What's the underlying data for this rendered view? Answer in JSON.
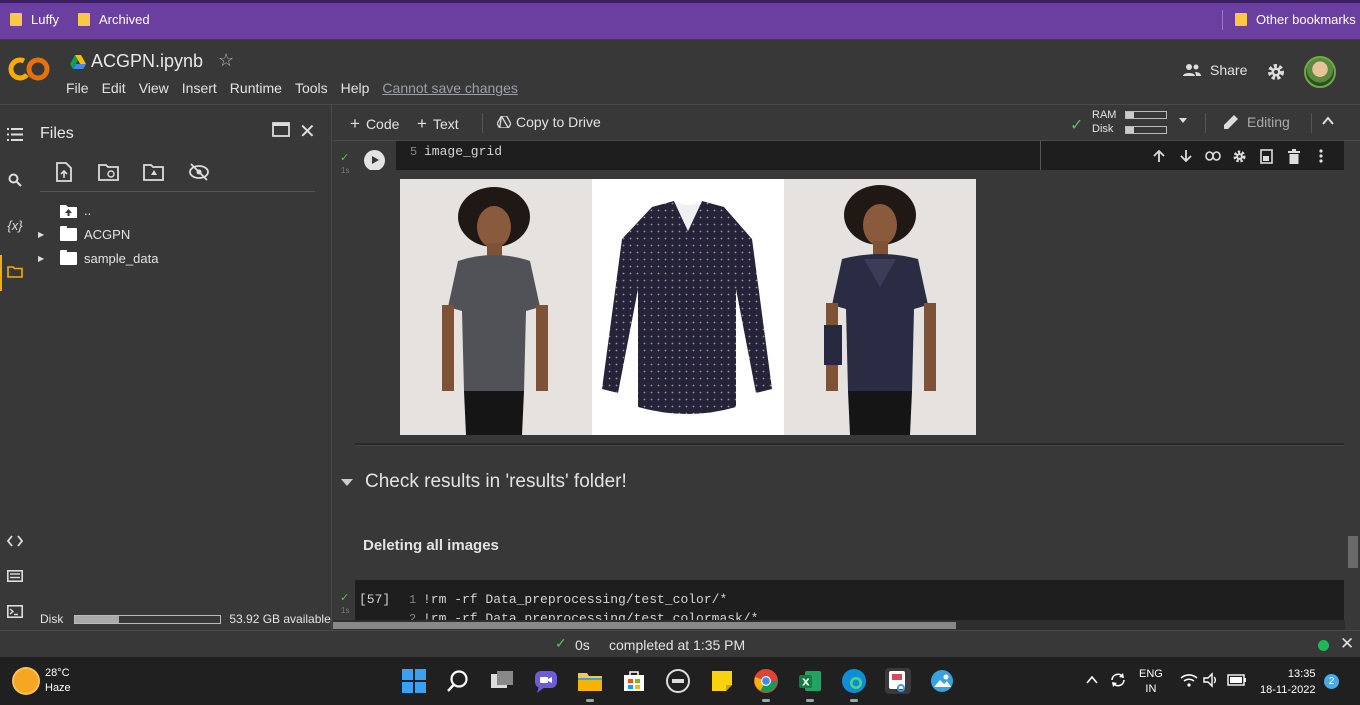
{
  "bookmarks": {
    "items": [
      "Luffy",
      "Archived"
    ],
    "other": "Other bookmarks"
  },
  "header": {
    "notebook_title": "ACGPN.ipynb",
    "menu": [
      "File",
      "Edit",
      "View",
      "Insert",
      "Runtime",
      "Tools",
      "Help"
    ],
    "cannot_save": "Cannot save changes",
    "share_label": "Share"
  },
  "rail": {
    "variables_label": "{x}"
  },
  "files": {
    "title": "Files",
    "tree": [
      {
        "label": ".."
      },
      {
        "label": "ACGPN"
      },
      {
        "label": "sample_data"
      }
    ],
    "disk_label": "Disk",
    "disk_available": "53.92 GB available",
    "disk_used_fraction": 0.3
  },
  "toolbar": {
    "code_label": "Code",
    "text_label": "Text",
    "copy_label": "Copy to Drive",
    "ram_label": "RAM",
    "disk_label": "Disk",
    "ram_used_fraction": 0.2,
    "disk_used_fraction": 0.2,
    "editing_label": "Editing"
  },
  "cell1": {
    "line_number": "5",
    "code": "image_grid",
    "gutter_time": "1s"
  },
  "section": {
    "heading": "Check results in 'results' folder!"
  },
  "text_cell": {
    "text": "Deleting all images"
  },
  "cell2": {
    "exec_count": "[57]",
    "gutter_time": "1s",
    "lines": [
      {
        "n": "1",
        "code": "!rm -rf Data_preprocessing/test_color/*"
      },
      {
        "n": "2",
        "code": "!rm -rf Data_preprocessing/test_colormask/*"
      }
    ]
  },
  "status": {
    "time": "0s",
    "message": "completed at 1:35 PM"
  },
  "taskbar": {
    "temp": "28°C",
    "weather": "Haze",
    "lang_top": "ENG",
    "lang_bottom": "IN",
    "clock_time": "13:35",
    "clock_date": "18-11-2022",
    "notifications": "2"
  },
  "colors": {
    "bookmark_bar": "#6b3fa0",
    "colab_bg": "#383838",
    "code_bg": "#1e1e1e",
    "success_green": "#5cbf5c"
  }
}
